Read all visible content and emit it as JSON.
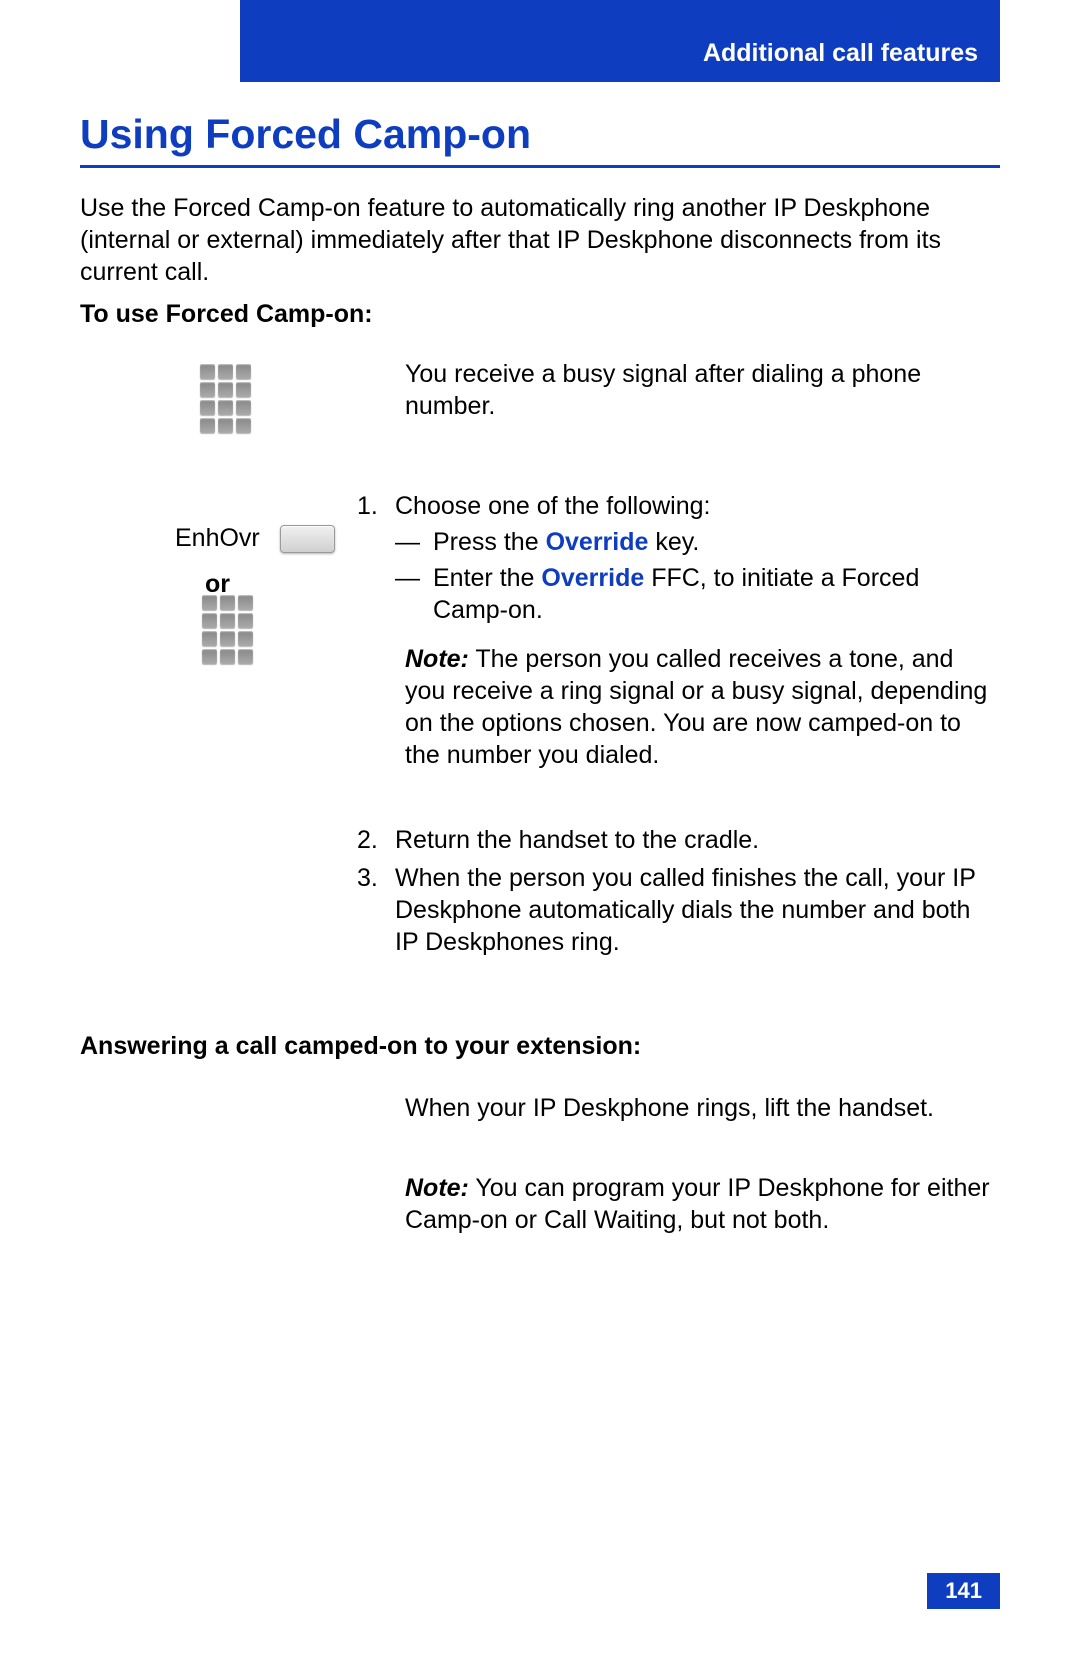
{
  "header": "Additional call features",
  "title": "Using Forced Camp-on",
  "intro": "Use the Forced Camp-on feature to automatically ring another IP Deskphone (internal or external) immediately after that IP Deskphone disconnects from its current call.",
  "subhead1": "To use Forced Camp-on:",
  "busy_text": "You receive a busy signal after dialing a phone number.",
  "enhovr": "EnhOvr",
  "or": "or",
  "step1": {
    "num": "1.",
    "lead": "Choose one of the following:",
    "a_pre": "Press the ",
    "a_bold": "Override",
    "a_post": " key.",
    "b_pre": "Enter the ",
    "b_bold": "Override",
    "b_post": " FFC, to initiate a Forced Camp-on."
  },
  "note1_label": "Note:",
  "note1_text": " The person you called receives a tone, and you receive a ring signal or a busy signal, depending on the options chosen. You are now camped-on to the number you dialed.",
  "step2": {
    "num": "2.",
    "text": "Return the handset to the cradle."
  },
  "step3": {
    "num": "3.",
    "text": "When the person you called finishes the call, your IP Deskphone automatically dials the number and both IP Deskphones ring."
  },
  "subhead2": "Answering a call camped-on to your extension:",
  "answer_text": "When your IP Deskphone rings, lift the handset.",
  "note2_label": "Note:",
  "note2_text": " You can program your IP Deskphone for either Camp-on or Call Waiting, but not both.",
  "page_number": "141"
}
